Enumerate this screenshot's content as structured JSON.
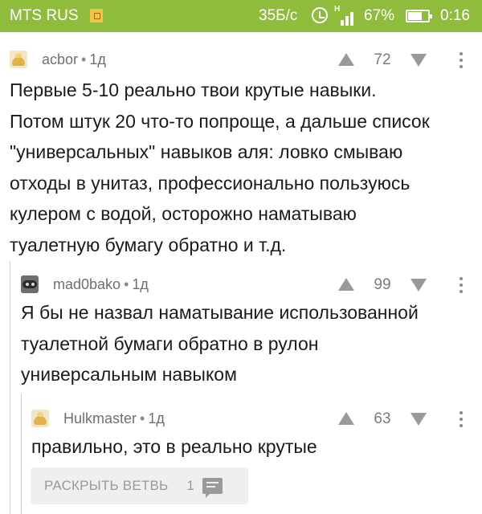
{
  "status_bar": {
    "carrier": "MTS RUS",
    "speed": "35Б/с",
    "battery": "67%",
    "time": "0:16",
    "network_type": "H"
  },
  "comments": [
    {
      "username": "acbor",
      "separator": "•",
      "age": "1д",
      "rating": "72",
      "avatar_icon": "pikabu-avatar-icon",
      "lines": [
        "Первые 5-10 реально твои крутые навыки.",
        "Потом штук 20 что-то попроще, а дальше список",
        "\"универсальных\" навыков аля: ловко смываю",
        "отходы в унитаз, профессионально пользуюсь",
        "кулером с водой, осторожно наматываю",
        "туалетную бумагу обратно и т.д."
      ]
    },
    {
      "username": "mad0bako",
      "separator": "•",
      "age": "1д",
      "rating": "99",
      "avatar_icon": "dark-avatar-icon",
      "lines": [
        "Я бы не назвал наматывание использованной",
        "туалетной бумаги обратно в рулон",
        "универсальным навыком"
      ]
    },
    {
      "username": "Hulkmaster",
      "separator": "•",
      "age": "1д",
      "rating": "63",
      "avatar_icon": "pikabu-avatar-icon",
      "lines": [
        "правильно, это в реально крутые"
      ]
    }
  ],
  "expand_branch": {
    "label": "РАСКРЫТЬ ВЕТВЬ",
    "count": "1",
    "icon": "comment-icon"
  },
  "colors": {
    "status_bar_bg": "#8fbc3d",
    "text": "#1b1b1b",
    "meta_text": "#6f6f6f"
  }
}
